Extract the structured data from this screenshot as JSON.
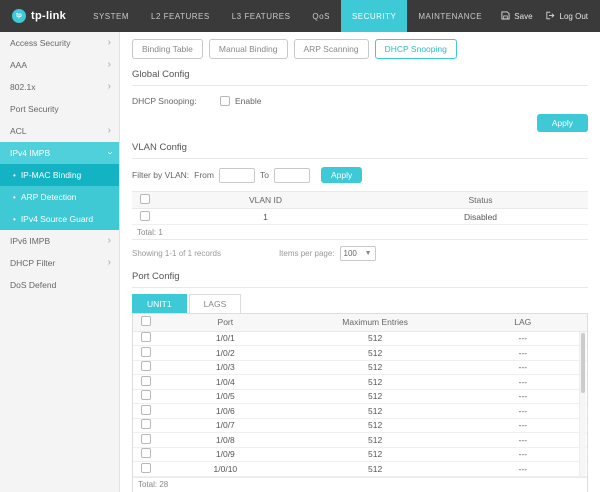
{
  "topbar": {
    "brand": "tp-link",
    "logo_initials": "tp",
    "nav": [
      "SYSTEM",
      "L2 FEATURES",
      "L3 FEATURES",
      "QoS",
      "SECURITY",
      "MAINTENANCE"
    ],
    "active_nav": "SECURITY",
    "save_label": "Save",
    "logout_label": "Log Out",
    "accent_color": "#3dc9d6",
    "bar_color": "#3a3a3a"
  },
  "sidebar": {
    "access_security": "Access Security",
    "aaa": "AAA",
    "dot1x": "802.1x",
    "port_security": "Port Security",
    "acl": "ACL",
    "ipv4_impb": "IPv4 IMPB",
    "ip_mac_binding": "IP-MAC Binding",
    "arp_detection": "ARP Detection",
    "ipv4_source_guard": "IPv4 Source Guard",
    "ipv6_impb": "IPv6 IMPB",
    "dhcp_filter": "DHCP Filter",
    "dos_defend": "DoS Defend",
    "active_parent": "IPv4 IMPB",
    "active_item": "IP-MAC Binding"
  },
  "content": {
    "tabs": [
      "Binding Table",
      "Manual Binding",
      "ARP Scanning",
      "DHCP Snooping"
    ],
    "active_tab": "DHCP Snooping",
    "global_config": {
      "title": "Global Config",
      "field_label": "DHCP Snooping:",
      "checkbox_label": "Enable",
      "checkbox_checked": false,
      "apply_label": "Apply"
    },
    "vlan_config": {
      "title": "VLAN Config",
      "filter_label": "Filter by VLAN:",
      "from_label": "From",
      "from_value": "",
      "to_label": "To",
      "to_value": "",
      "apply_label": "Apply",
      "table": {
        "headers": {
          "vlan_id": "VLAN ID",
          "status": "Status"
        },
        "rows": [
          {
            "vlan_id": "1",
            "status": "Disabled"
          }
        ],
        "total": "Total: 1"
      },
      "pagination": {
        "showing": "Showing 1-1 of 1 records",
        "items_per_page_label": "Items per page:",
        "items_per_page_value": "100"
      }
    },
    "port_config": {
      "title": "Port Config",
      "unit_tabs": [
        "UNIT1",
        "LAGS"
      ],
      "active_unit": "UNIT1",
      "table": {
        "headers": {
          "port": "Port",
          "max_entries": "Maximum Entries",
          "lag": "LAG"
        },
        "rows": [
          {
            "port": "1/0/1",
            "max": "512",
            "lag": "---"
          },
          {
            "port": "1/0/2",
            "max": "512",
            "lag": "---"
          },
          {
            "port": "1/0/3",
            "max": "512",
            "lag": "---"
          },
          {
            "port": "1/0/4",
            "max": "512",
            "lag": "---"
          },
          {
            "port": "1/0/5",
            "max": "512",
            "lag": "---"
          },
          {
            "port": "1/0/6",
            "max": "512",
            "lag": "---"
          },
          {
            "port": "1/0/7",
            "max": "512",
            "lag": "---"
          },
          {
            "port": "1/0/8",
            "max": "512",
            "lag": "---"
          },
          {
            "port": "1/0/9",
            "max": "512",
            "lag": "---"
          },
          {
            "port": "1/0/10",
            "max": "512",
            "lag": "---"
          }
        ],
        "total": "Total: 28"
      }
    }
  }
}
